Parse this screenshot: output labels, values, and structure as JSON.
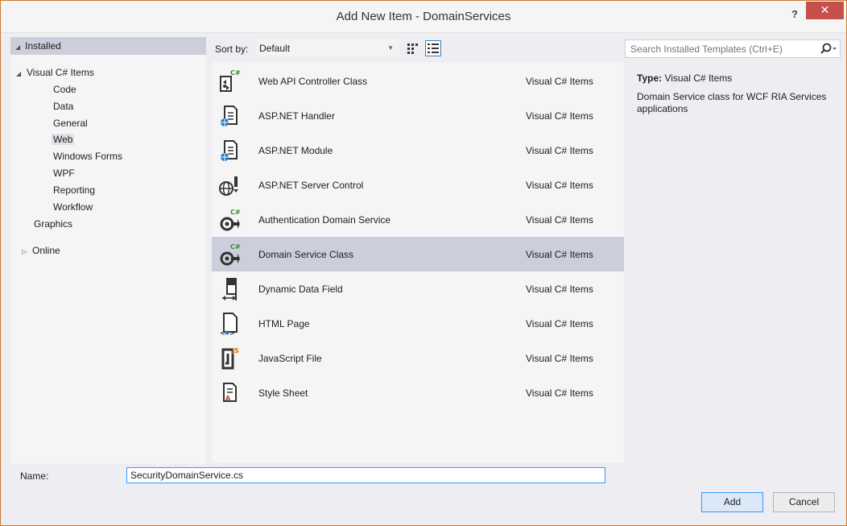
{
  "window": {
    "title": "Add New Item - DomainServices",
    "help_label": "?",
    "close_label": "✕",
    "frame_color": "#c97a35"
  },
  "tree": {
    "installed": "Installed",
    "items": [
      {
        "label": "Visual C# Items",
        "icon": "expanded-triangle"
      },
      {
        "label": "Code"
      },
      {
        "label": "Data"
      },
      {
        "label": "General"
      },
      {
        "label": "Web"
      },
      {
        "label": "Windows Forms"
      },
      {
        "label": "WPF"
      },
      {
        "label": "Reporting"
      },
      {
        "label": "Workflow"
      },
      {
        "label": "Graphics"
      },
      {
        "label": "Online",
        "icon": "collapsed-triangle"
      }
    ],
    "selected": "Web"
  },
  "toolbar": {
    "sort_label": "Sort by:",
    "sort_value": "Default",
    "small_icons_view": "small-icons-view-icon",
    "list_view": "list-view-icon"
  },
  "search": {
    "placeholder": "Search Installed Templates (Ctrl+E)"
  },
  "templates": [
    {
      "name": "Web API Controller Class",
      "category": "Visual C# Items",
      "icon": "web-api-controller-icon"
    },
    {
      "name": "ASP.NET Handler",
      "category": "Visual C# Items",
      "icon": "aspnet-handler-icon"
    },
    {
      "name": "ASP.NET Module",
      "category": "Visual C# Items",
      "icon": "aspnet-module-icon"
    },
    {
      "name": "ASP.NET Server Control",
      "category": "Visual C# Items",
      "icon": "server-control-icon"
    },
    {
      "name": "Authentication Domain Service",
      "category": "Visual C# Items",
      "icon": "auth-domain-service-icon"
    },
    {
      "name": "Domain Service Class",
      "category": "Visual C# Items",
      "icon": "domain-service-icon",
      "selected": true
    },
    {
      "name": "Dynamic Data Field",
      "category": "Visual C# Items",
      "icon": "dynamic-data-field-icon"
    },
    {
      "name": "HTML Page",
      "category": "Visual C# Items",
      "icon": "html-page-icon"
    },
    {
      "name": "JavaScript File",
      "category": "Visual C# Items",
      "icon": "javascript-file-icon"
    },
    {
      "name": "Style Sheet",
      "category": "Visual C# Items",
      "icon": "style-sheet-icon"
    }
  ],
  "info": {
    "type_label": "Type:",
    "type_value": "Visual C# Items",
    "description": "Domain Service class for WCF RIA Services applications"
  },
  "footer": {
    "name_label": "Name:",
    "name_value": "SecurityDomainService.cs",
    "add_label": "Add",
    "cancel_label": "Cancel"
  }
}
